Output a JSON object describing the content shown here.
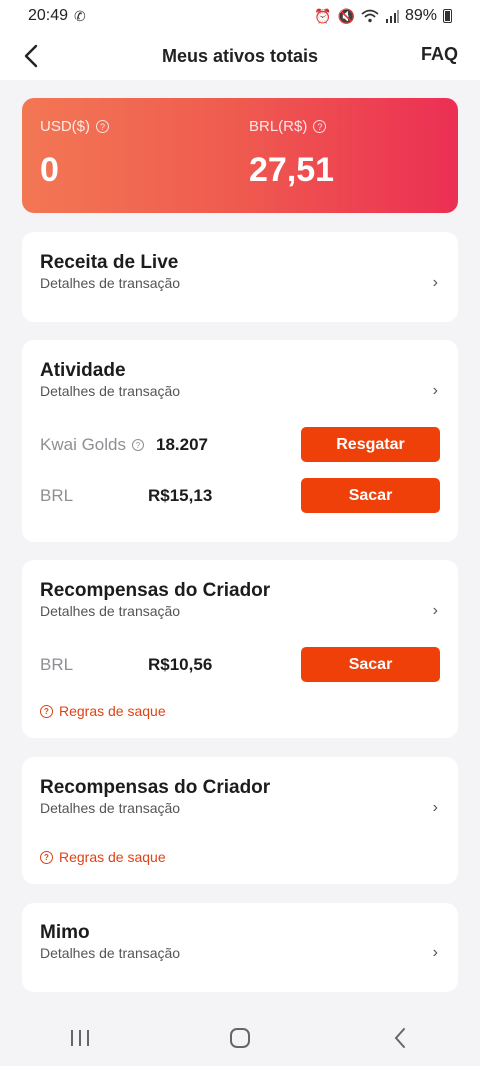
{
  "status_bar": {
    "time": "20:49",
    "battery": "89%"
  },
  "header": {
    "title": "Meus ativos totais",
    "faq": "FAQ"
  },
  "assets": {
    "usd_label": "USD($)",
    "usd_value": "0",
    "brl_label": "BRL(R$)",
    "brl_value": "27,51"
  },
  "live": {
    "title": "Receita de Live",
    "subtitle": "Detalhes de transação"
  },
  "activity": {
    "title": "Atividade",
    "subtitle": "Detalhes de transação",
    "golds_label": "Kwai Golds",
    "golds_value": "18.207",
    "redeem_label": "Resgatar",
    "brl_label": "BRL",
    "brl_value": "R$15,13",
    "withdraw_label": "Sacar"
  },
  "creator1": {
    "title": "Recompensas do Criador",
    "subtitle": "Detalhes de transação",
    "brl_label": "BRL",
    "brl_value": "R$10,56",
    "withdraw_label": "Sacar",
    "rules": "Regras de saque"
  },
  "creator2": {
    "title": "Recompensas do Criador",
    "subtitle": "Detalhes de transação",
    "rules": "Regras de saque"
  },
  "gift": {
    "title": "Mimo",
    "subtitle": "Detalhes de transação"
  },
  "colors": {
    "accent": "#f0400a",
    "card_gradient_start": "#f37754",
    "card_gradient_end": "#ec2f54"
  },
  "icons": [
    "back-arrow-icon",
    "help-icon",
    "chevron-right-icon",
    "recents-icon",
    "home-icon",
    "back-nav-icon"
  ]
}
